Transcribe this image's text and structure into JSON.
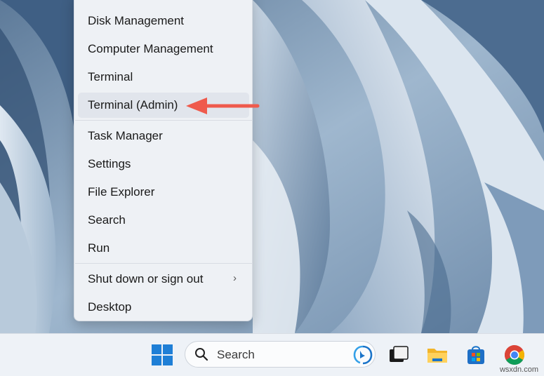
{
  "menu": {
    "items": [
      {
        "label": "Disk Management"
      },
      {
        "label": "Computer Management"
      },
      {
        "label": "Terminal"
      },
      {
        "label": "Terminal (Admin)"
      },
      {
        "label": "Task Manager"
      },
      {
        "label": "Settings"
      },
      {
        "label": "File Explorer"
      },
      {
        "label": "Search"
      },
      {
        "label": "Run"
      },
      {
        "label": "Shut down or sign out"
      },
      {
        "label": "Desktop"
      }
    ],
    "highlighted_item": "Terminal (Admin)",
    "submenu_chevron": "›"
  },
  "annotation": {
    "arrow_color": "#ef5a4c"
  },
  "taskbar": {
    "search_placeholder": "Search",
    "icons": [
      "windows-start-icon",
      "search-icon",
      "bing-icon",
      "task-view-icon",
      "file-explorer-icon",
      "microsoft-store-icon",
      "chrome-icon"
    ]
  },
  "watermark": "wsxdn.com"
}
